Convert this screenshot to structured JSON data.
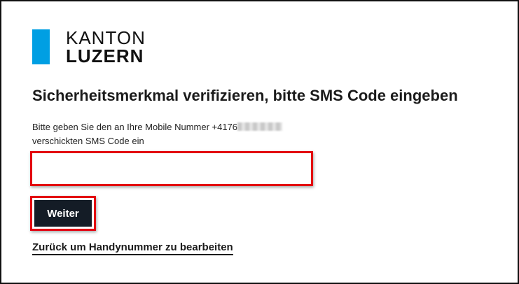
{
  "logo": {
    "line1": "KANTON",
    "line2": "LUZERN",
    "bar_color": "#009fe3"
  },
  "heading": "Sicherheitsmerkmal verifizieren, bitte SMS Code eingeben",
  "instruction": {
    "prefix": "Bitte geben Sie den an Ihre Mobile Nummer +4176",
    "suffix": "verschickten SMS Code ein"
  },
  "code_input": {
    "value": "",
    "placeholder": ""
  },
  "buttons": {
    "weiter": "Weiter"
  },
  "back_link": "Zurück um Handynummer zu bearbeiten",
  "colors": {
    "highlight": "#e3000f",
    "button_bg": "#141c26",
    "brand": "#009fe3"
  }
}
